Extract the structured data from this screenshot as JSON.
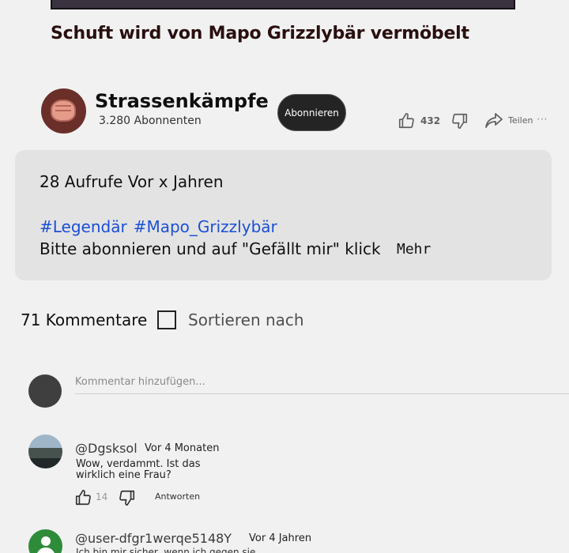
{
  "video": {
    "title": "Schuft wird von Mapo Grizzlybär vermöbelt"
  },
  "channel": {
    "name": "Strassenkämpfe",
    "subscribers": "3.280 Abonnenten",
    "subscribe_label": "Abonnieren"
  },
  "actions": {
    "likes": "432",
    "share_label": "Teilen",
    "more_icon": "more-horizontal-icon"
  },
  "description": {
    "views_time": "28 Aufrufe Vor x Jahren",
    "hashtags": [
      "#Legendär",
      "#Mapo_Grizzlybär"
    ],
    "text": "Bitte abonnieren und auf \"Gefällt mir\" klick",
    "more_label": "Mehr"
  },
  "comments_header": {
    "count_label": "71 Kommentare",
    "sort_label": "Sortieren nach"
  },
  "add_comment": {
    "placeholder": "Kommentar hinzufügen..."
  },
  "comments": [
    {
      "author": "@Dgsksol",
      "time": "Vor 4 Monaten",
      "text": "Wow, verdammt. Ist das wirklich eine Frau?",
      "likes": "14",
      "reply_label": "Antworten"
    },
    {
      "author": "@user-dfgr1werqe5148Y",
      "time": "Vor 4 Jahren",
      "text": "Ich bin mir sicher, wenn ich gegen sie"
    }
  ],
  "colors": {
    "hashtag": "#1a4fd6",
    "subscribe_bg": "#242424",
    "description_bg": "#e3e3e3",
    "background": "#f1f1f1"
  }
}
